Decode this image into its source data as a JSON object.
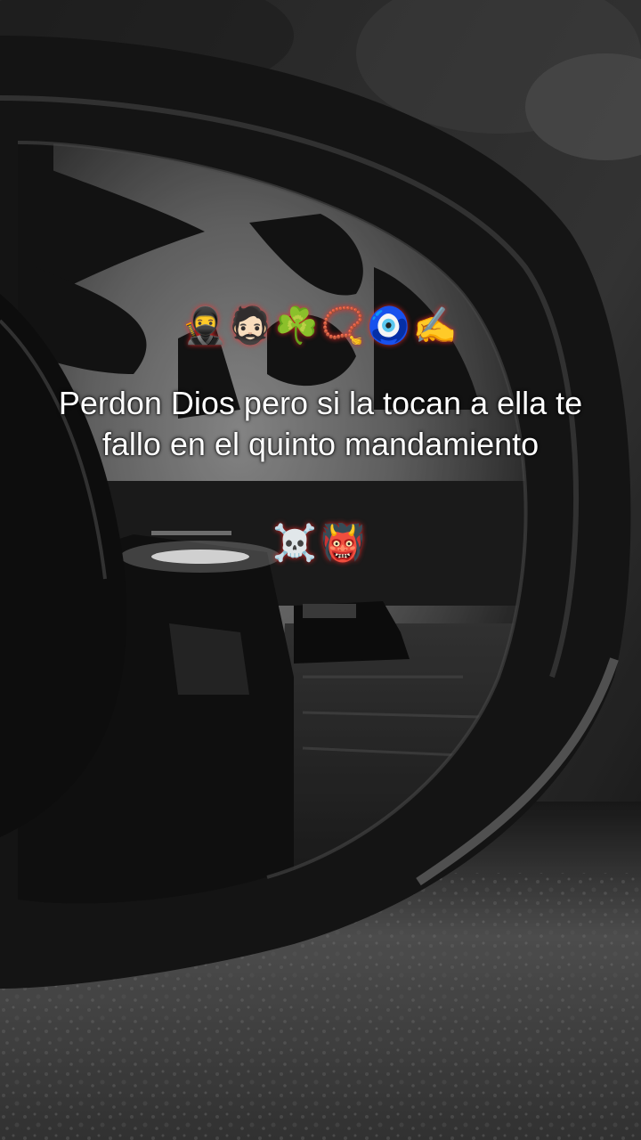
{
  "post": {
    "emoji_top": "🥷🧔🏻☘️📿🧿✍️",
    "caption": "Perdon Dios pero si la tocan a ella te fallo en el quinto mandamiento",
    "emoji_bottom": "☠️👹"
  },
  "background": {
    "subject": "side-mirror",
    "style": "black-and-white photo",
    "glow_color": "#ff2a2a"
  }
}
